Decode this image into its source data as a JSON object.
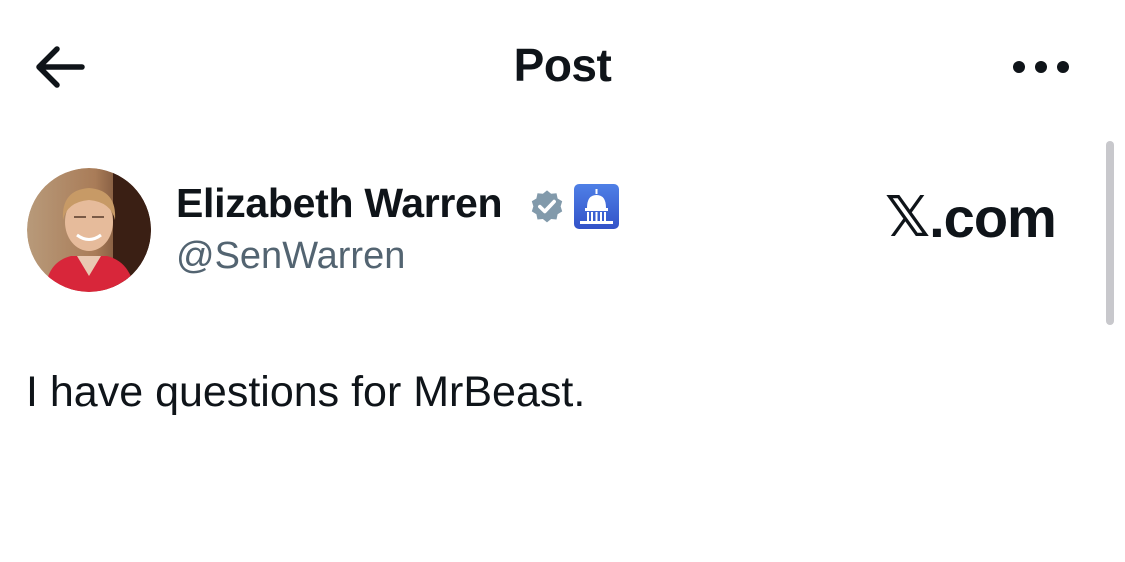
{
  "header": {
    "title": "Post",
    "back_icon": "arrow-left-icon",
    "more_icon": "more-horizontal-icon"
  },
  "post": {
    "author": {
      "name": "Elizabeth Warren",
      "handle": "@SenWarren",
      "verified_icon": "verified-badge-icon",
      "affiliation_icon": "capitol-building-icon"
    },
    "text": "I have questions for MrBeast."
  },
  "overlay": {
    "logo_symbol": "𝕏",
    "logo_suffix": ".com"
  },
  "colors": {
    "text": "#0f1419",
    "secondary_text": "#536471",
    "verified_badge": "#829aab",
    "affiliation_badge": "#3d63de",
    "scrollbar": "#c8c8cc"
  }
}
